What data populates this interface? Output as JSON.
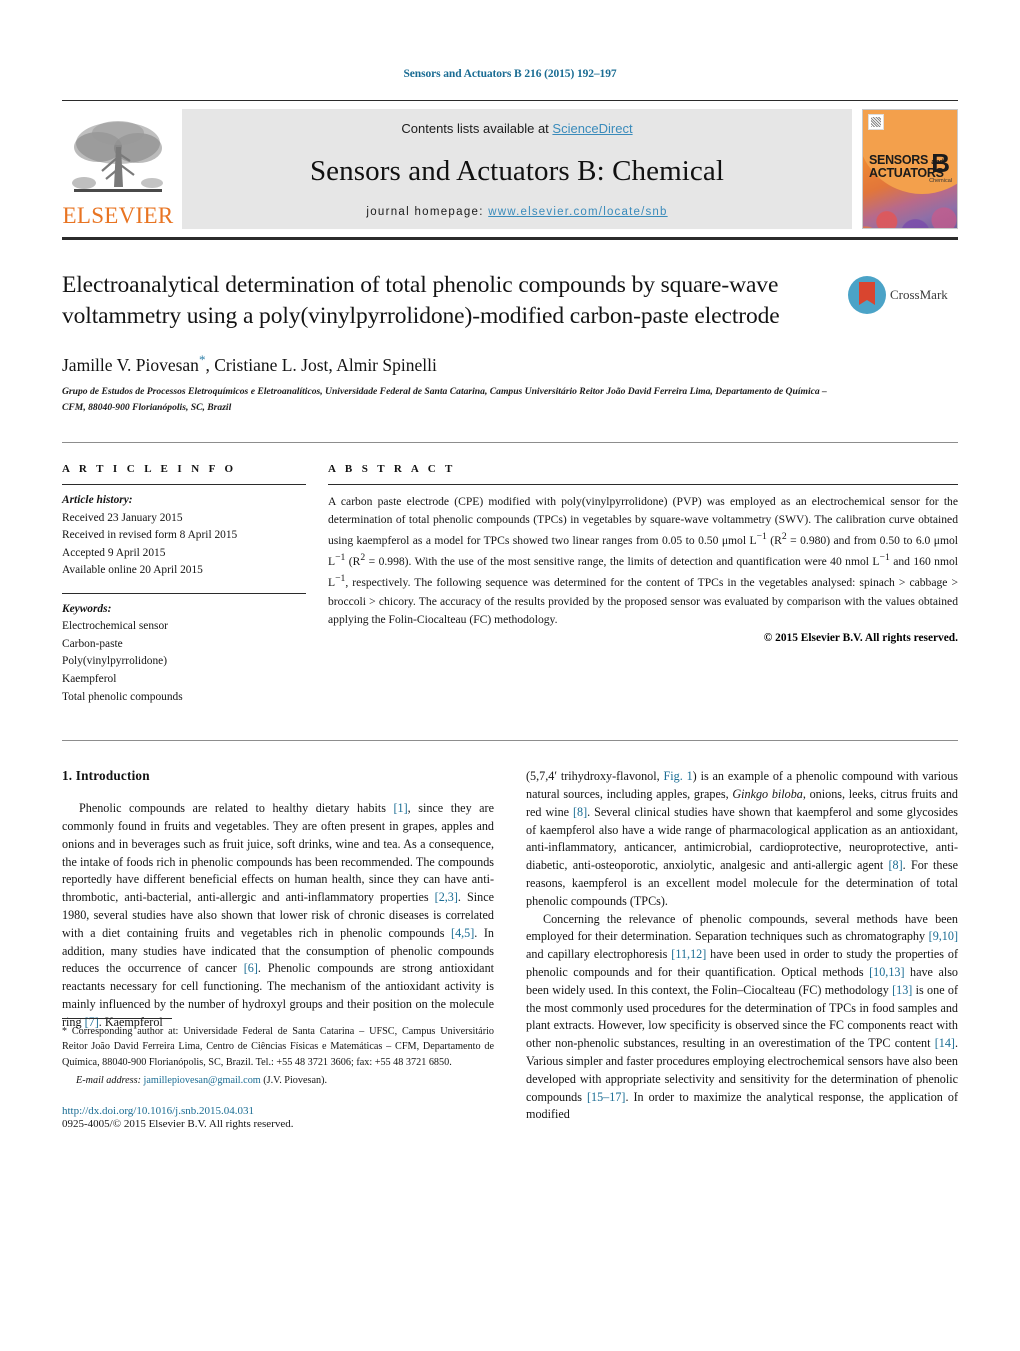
{
  "running_head": "Sensors and Actuators B 216 (2015) 192–197",
  "masthead": {
    "contents_prefix": "Contents lists available at ",
    "sciencedirect": "ScienceDirect",
    "journal_title": "Sensors and Actuators B: Chemical",
    "homepage_label": "journal homepage:",
    "homepage_url": "www.elsevier.com/locate/snb",
    "publisher": "ELSEVIER",
    "publisher_logo_icon": "elsevier-tree-icon",
    "cover": {
      "line1": "SENSORS",
      "line1_small": "and",
      "line2": "ACTUATORS",
      "series": "B",
      "series_sub": "Chemical",
      "accent": "#ef8a32"
    },
    "link_color": "#3a8bbb"
  },
  "crossmark": {
    "label": "CrossMark",
    "icon": "crossmark-icon",
    "ring_color": "#4ba3c7",
    "mark_color": "#d9452f"
  },
  "article": {
    "title": "Electroanalytical determination of total phenolic compounds by square-wave voltammetry using a poly(vinylpyrrolidone)-modified carbon-paste electrode",
    "authors": "Jamille V. Piovesan",
    "authors_rest": ", Cristiane L. Jost, Almir Spinelli",
    "corresponding_marker": "*",
    "affiliation": "Grupo de Estudos de Processos Eletroquímicos e Eletroanalíticos, Universidade Federal de Santa Catarina, Campus Universitário Reitor João David Ferreira Lima, Departamento de Química – CFM, 88040-900 Florianópolis, SC, Brazil"
  },
  "article_info": {
    "heading": "A R T I C L E   I N F O",
    "history_label": "Article history:",
    "history": [
      "Received 23 January 2015",
      "Received in revised form 8 April 2015",
      "Accepted 9 April 2015",
      "Available online 20 April 2015"
    ],
    "keywords_label": "Keywords:",
    "keywords": [
      "Electrochemical sensor",
      "Carbon-paste",
      "Poly(vinylpyrrolidone)",
      "Kaempferol",
      "Total phenolic compounds"
    ]
  },
  "abstract": {
    "heading": "A B S T R A C T",
    "paragraph": "A carbon paste electrode (CPE) modified with poly(vinylpyrrolidone) (PVP) was employed as an electrochemical sensor for the determination of total phenolic compounds (TPCs) in vegetables by square-wave voltammetry (SWV). The calibration curve obtained using kaempferol as a model for TPCs showed two linear ranges from 0.05 to 0.50 μmol L−1 (R2 = 0.980) and from 0.50 to 6.0 μmol L−1 (R2 = 0.998). With the use of the most sensitive range, the limits of detection and quantification were 40 nmol L−1 and 160 nmol L−1, respectively. The following sequence was determined for the content of TPCs in the vegetables analysed: spinach > cabbage > broccoli > chicory. The accuracy of the results provided by the proposed sensor was evaluated by comparison with the values obtained applying the Folin-Ciocalteau (FC) methodology.",
    "copyright": "© 2015 Elsevier B.V. All rights reserved."
  },
  "introduction": {
    "heading": "1.  Introduction",
    "left_paragraphs": [
      "Phenolic compounds are related to healthy dietary habits [1], since they are commonly found in fruits and vegetables. They are often present in grapes, apples and onions and in beverages such as fruit juice, soft drinks, wine and tea. As a consequence, the intake of foods rich in phenolic compounds has been recommended. The compounds reportedly have different beneficial effects on human health, since they can have anti-thrombotic, anti-bacterial, anti-allergic and anti-inflammatory properties [2,3]. Since 1980, several studies have also shown that lower risk of chronic diseases is correlated with a diet containing fruits and vegetables rich in phenolic compounds [4,5]. In addition, many studies have indicated that the consumption of phenolic compounds reduces the occurrence of cancer [6]. Phenolic compounds are strong antioxidant reactants necessary for cell functioning. The mechanism of the antioxidant activity is mainly influenced by the number of hydroxyl groups and their position on the molecule ring [7]. Kaempferol"
    ],
    "right_paragraphs": [
      "(5,7,4′ trihydroxy-flavonol, Fig. 1) is an example of a phenolic compound with various natural sources, including apples, grapes, Ginkgo biloba, onions, leeks, citrus fruits and red wine [8]. Several clinical studies have shown that kaempferol and some glycosides of kaempferol also have a wide range of pharmacological application as an antioxidant, anti-inflammatory, anticancer, antimicrobial, cardioprotective, neuroprotective, anti-diabetic, anti-osteoporotic, anxiolytic, analgesic and anti-allergic agent [8]. For these reasons, kaempferol is an excellent model molecule for the determination of total phenolic compounds (TPCs).",
      "Concerning the relevance of phenolic compounds, several methods have been employed for their determination. Separation techniques such as chromatography [9,10] and capillary electrophoresis [11,12] have been used in order to study the properties of phenolic compounds and for their quantification. Optical methods [10,13] have also been widely used. In this context, the Folin–Ciocalteau (FC) methodology [13] is one of the most commonly used procedures for the determination of TPCs in food samples and plant extracts. However, low specificity is observed since the FC components react with other non-phenolic substances, resulting in an overestimation of the TPC content [14]. Various simpler and faster procedures employing electrochemical sensors have also been developed with appropriate selectivity and sensitivity for the determination of phenolic compounds [15–17]. In order to maximize the analytical response, the application of modified"
    ]
  },
  "footnote": {
    "marker": "*",
    "text": "Corresponding author at: Universidade Federal de Santa Catarina – UFSC, Campus Universitário Reitor João David Ferreira Lima, Centro de Ciências Físicas e Matemáticas – CFM, Departamento de Química, 88040-900 Florianópolis, SC, Brazil. Tel.: +55 48 3721 3606; fax: +55 48 3721 6850.",
    "email_label": "E-mail address:",
    "email": "jamillepiovesan@gmail.com",
    "email_attrib": "(J.V. Piovesan).",
    "doi": "http://dx.doi.org/10.1016/j.snb.2015.04.031",
    "issn": "0925-4005/© 2015 Elsevier B.V. All rights reserved."
  }
}
